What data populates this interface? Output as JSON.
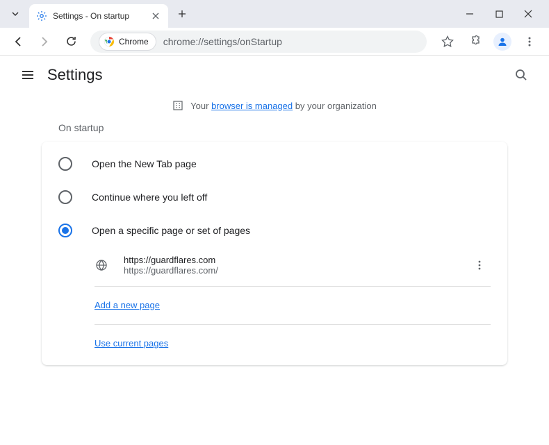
{
  "titlebar": {
    "tab_title": "Settings - On startup"
  },
  "toolbar": {
    "chrome_chip": "Chrome",
    "url": "chrome://settings/onStartup"
  },
  "settings": {
    "title": "Settings"
  },
  "managed": {
    "prefix": "Your ",
    "link": "browser is managed",
    "suffix": " by your organization"
  },
  "section": {
    "label": "On startup"
  },
  "radios": {
    "new_tab": "Open the New Tab page",
    "continue": "Continue where you left off",
    "specific": "Open a specific page or set of pages"
  },
  "page_entry": {
    "title": "https://guardflares.com",
    "url": "https://guardflares.com/"
  },
  "links": {
    "add_page": "Add a new page",
    "use_current": "Use current pages"
  }
}
